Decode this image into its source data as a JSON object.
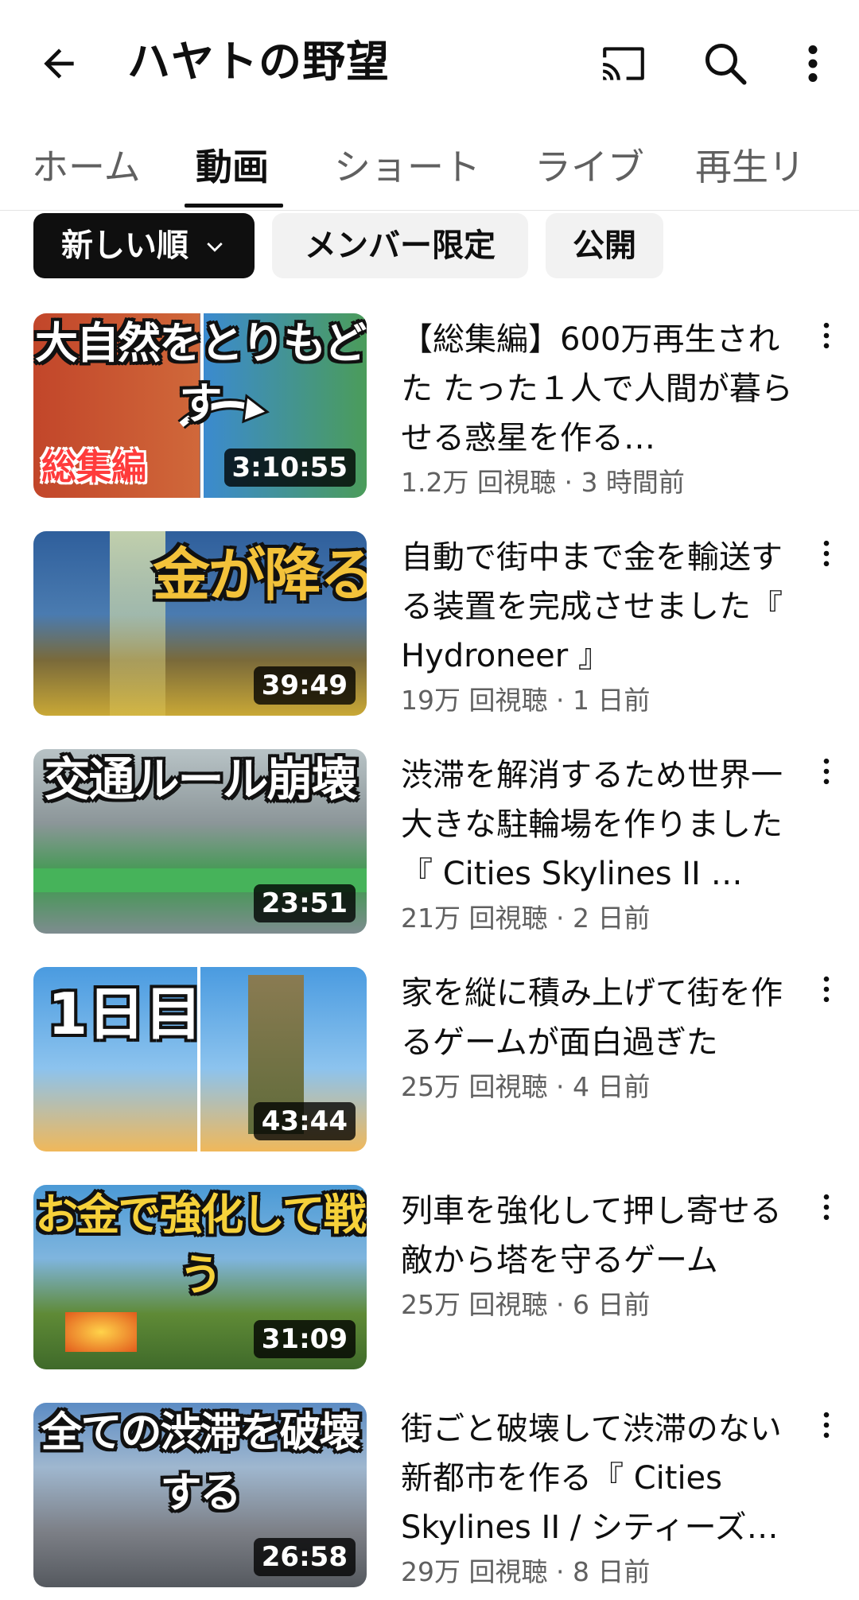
{
  "header": {
    "title": "ハヤトの野望",
    "icons": [
      "arrow-left-icon",
      "cast-icon",
      "search-icon",
      "more-vertical-icon"
    ]
  },
  "tabs": [
    {
      "label": "ホーム"
    },
    {
      "label": "動画"
    },
    {
      "label": "ショート"
    },
    {
      "label": "ライブ"
    },
    {
      "label": "再生リ"
    }
  ],
  "chips": [
    {
      "label": "新しい順"
    },
    {
      "label": "メンバー限定"
    },
    {
      "label": "公開"
    }
  ],
  "videos": [
    {
      "thumb_text": "大自然をとりもどす",
      "thumb_badge": "総集編",
      "duration": "3:10:55",
      "title": "【総集編】600万再生された たった１人で人間が暮らせる惑星を作る…",
      "meta": "1.2万 回視聴 · 3 時間前",
      "thumb_colors": [
        "#c2462a",
        "#3b8ad2"
      ]
    },
    {
      "thumb_text": "金が降る",
      "duration": "39:49",
      "title": "自動で街中まで金を輸送する装置を完成させました『 Hydroneer 』",
      "meta": "19万 回視聴 · 1 日前",
      "thumb_colors": [
        "#2f5f9c",
        "#c9a836"
      ]
    },
    {
      "thumb_text": "交通ルール崩壊",
      "duration": "23:51",
      "title": "渋滞を解消するため世界一大きな駐輪場を作りました『 Cities Skylines II …",
      "meta": "21万 回視聴 · 2 日前",
      "thumb_colors": [
        "#7e8c8f",
        "#3c9a4c"
      ]
    },
    {
      "thumb_text": "1日目",
      "duration": "43:44",
      "title": "家を縦に積み上げて街を作るゲームが面白過ぎた",
      "meta": "25万 回視聴 · 4 日前",
      "thumb_colors": [
        "#4a9be0",
        "#f0b85a"
      ]
    },
    {
      "thumb_text": "お金で強化して戦う",
      "duration": "31:09",
      "title": "列車を強化して押し寄せる敵から塔を守るゲーム",
      "meta": "25万 回視聴 · 6 日前",
      "thumb_colors": [
        "#4b9ad6",
        "#5f8a36"
      ]
    },
    {
      "thumb_text": "全ての渋滞を破壊する",
      "duration": "26:58",
      "title": "街ごと破壊して渋滞のない新都市を作る『 Cities Skylines II / シティーズ…",
      "meta": "29万 回視聴 · 8 日前",
      "thumb_colors": [
        "#5c8cc4",
        "#7c7f86"
      ]
    }
  ]
}
